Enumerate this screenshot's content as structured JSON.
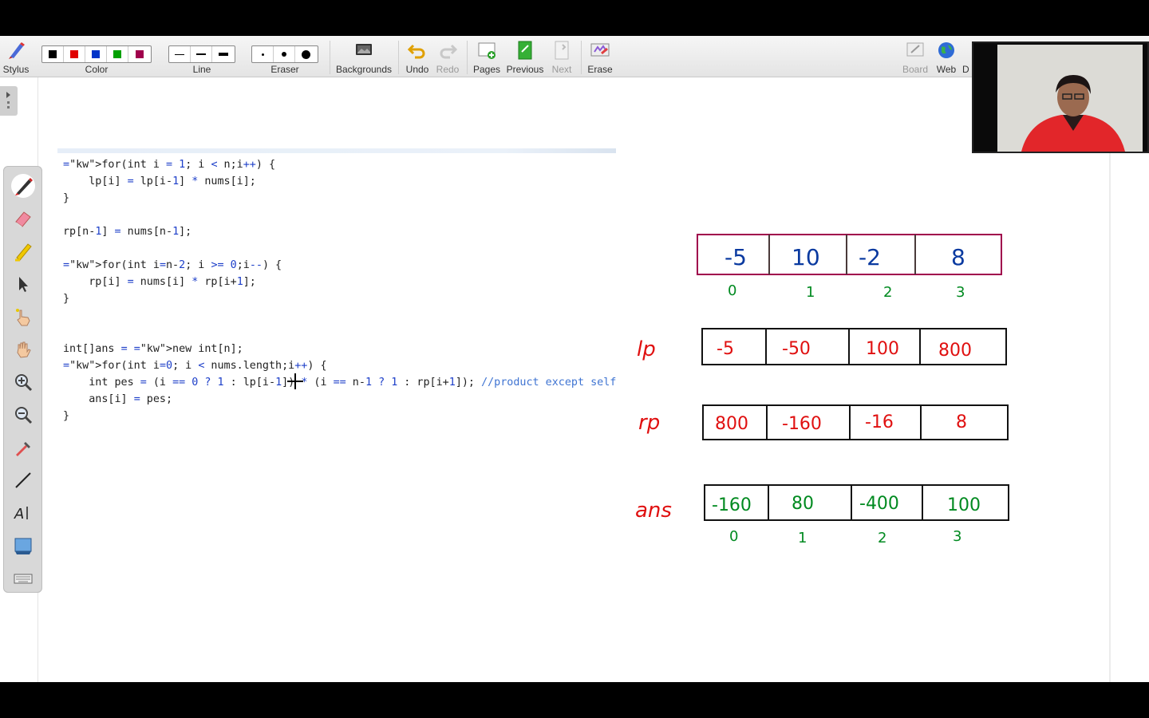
{
  "toolbar": {
    "stylus": "Stylus",
    "color": "Color",
    "line": "Line",
    "eraser": "Eraser",
    "backgrounds": "Backgrounds",
    "undo": "Undo",
    "redo": "Redo",
    "pages": "Pages",
    "previous": "Previous",
    "next": "Next",
    "erase": "Erase",
    "board": "Board",
    "web": "Web",
    "d": "D",
    "colors": [
      "#000000",
      "#e00000",
      "#0034c8",
      "#00a000",
      "#a0004c"
    ]
  },
  "code": {
    "lines": [
      "for(int i = 1; i < n;i++) {",
      "    lp[i] = lp[i-1] * nums[i];",
      "}",
      "",
      "rp[n-1] = nums[n-1];",
      "",
      "for(int i=n-2; i >= 0;i--) {",
      "    rp[i] = nums[i] * rp[i+1];",
      "}",
      "",
      "",
      "int[]ans = new int[n];",
      "for(int i=0; i < nums.length;i++) {",
      "    int pes = (i == 0 ? 1 : lp[i-1]) * (i == n-1 ? 1 : rp[i+1]); //product except self",
      "    ans[i] = pes;",
      "}"
    ]
  },
  "whiteboard": {
    "nums": [
      "-5",
      "10",
      "-2",
      "8"
    ],
    "nums_indices": [
      "0",
      "1",
      "2",
      "3"
    ],
    "lp_label": "lp",
    "lp": [
      "-5",
      "-50",
      "100",
      "800"
    ],
    "rp_label": "rp",
    "rp": [
      "800",
      "-160",
      "-16",
      "8"
    ],
    "ans_label": "ans",
    "ans": [
      "-160",
      "80",
      "-400",
      "100"
    ],
    "ans_indices": [
      "0",
      "1",
      "2",
      "3"
    ]
  }
}
